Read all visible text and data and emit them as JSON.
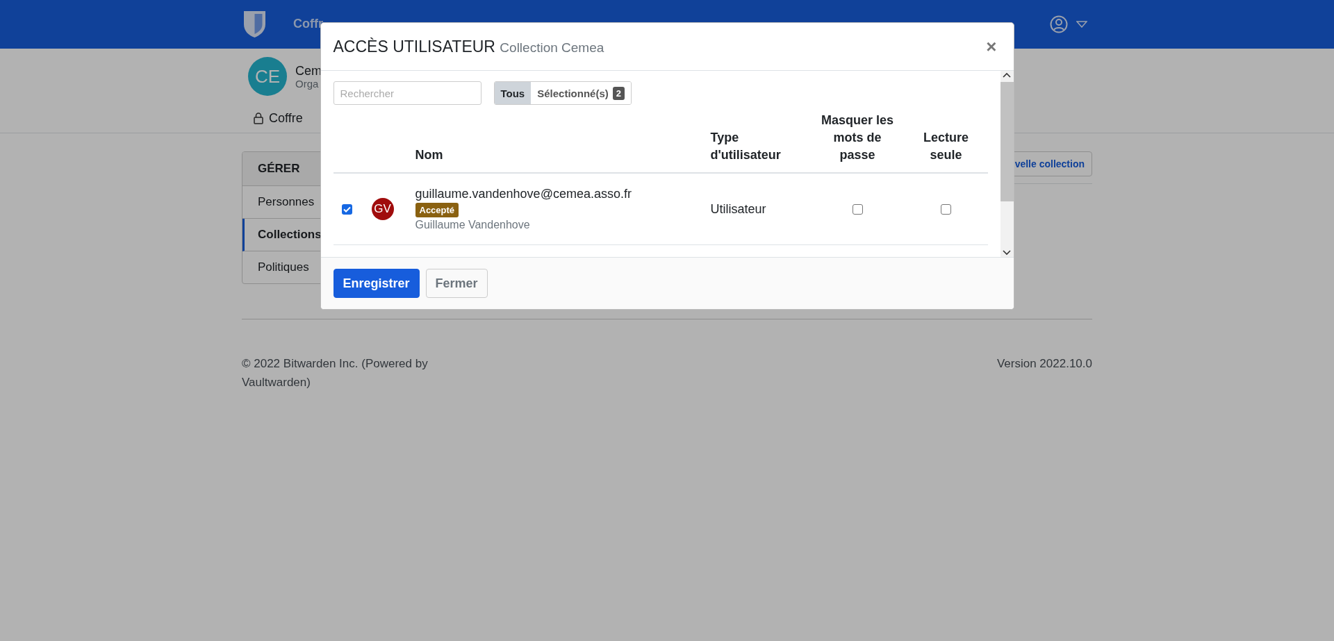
{
  "navbar": {
    "nav_items": [
      "Coffr"
    ]
  },
  "organization": {
    "avatar": "CE",
    "name": "Cem",
    "subtitle": "Orga"
  },
  "org_tabs": [
    {
      "label": "Coffre"
    }
  ],
  "sidebar": {
    "heading": "GÉRER",
    "items": [
      {
        "label": "Personnes",
        "selected": false
      },
      {
        "label": "Collections",
        "selected": true
      },
      {
        "label": "Politiques",
        "selected": false
      }
    ]
  },
  "new_collection_button": "velle collection",
  "footer": {
    "copyright": "© 2022 Bitwarden Inc. (Powered by Vaultwarden)",
    "version": "Version 2022.10.0"
  },
  "modal": {
    "title": "ACCÈS UTILISATEUR",
    "subtitle": "Collection Cemea",
    "close": "×",
    "search": {
      "placeholder": "Rechercher"
    },
    "filters": [
      {
        "label": "Tous",
        "selected": true
      },
      {
        "label": "Sélectionné(s)",
        "count": "2",
        "selected": false
      }
    ],
    "columns": [
      "Nom",
      "Type d'utilisateur",
      "Masquer les mots de passe",
      "Lecture seule"
    ],
    "rows": [
      {
        "checked": true,
        "initials": "GV",
        "email": "guillaume.vandenhove@cemea.asso.fr",
        "status": "Accepté",
        "name": "Guillaume Vandenhove",
        "user_type": "Utilisateur",
        "hide_passwords": false,
        "read_only": false
      }
    ],
    "buttons": [
      {
        "label": "Enregistrer",
        "kind": "primary"
      },
      {
        "label": "Fermer",
        "kind": "secondary"
      }
    ]
  }
}
